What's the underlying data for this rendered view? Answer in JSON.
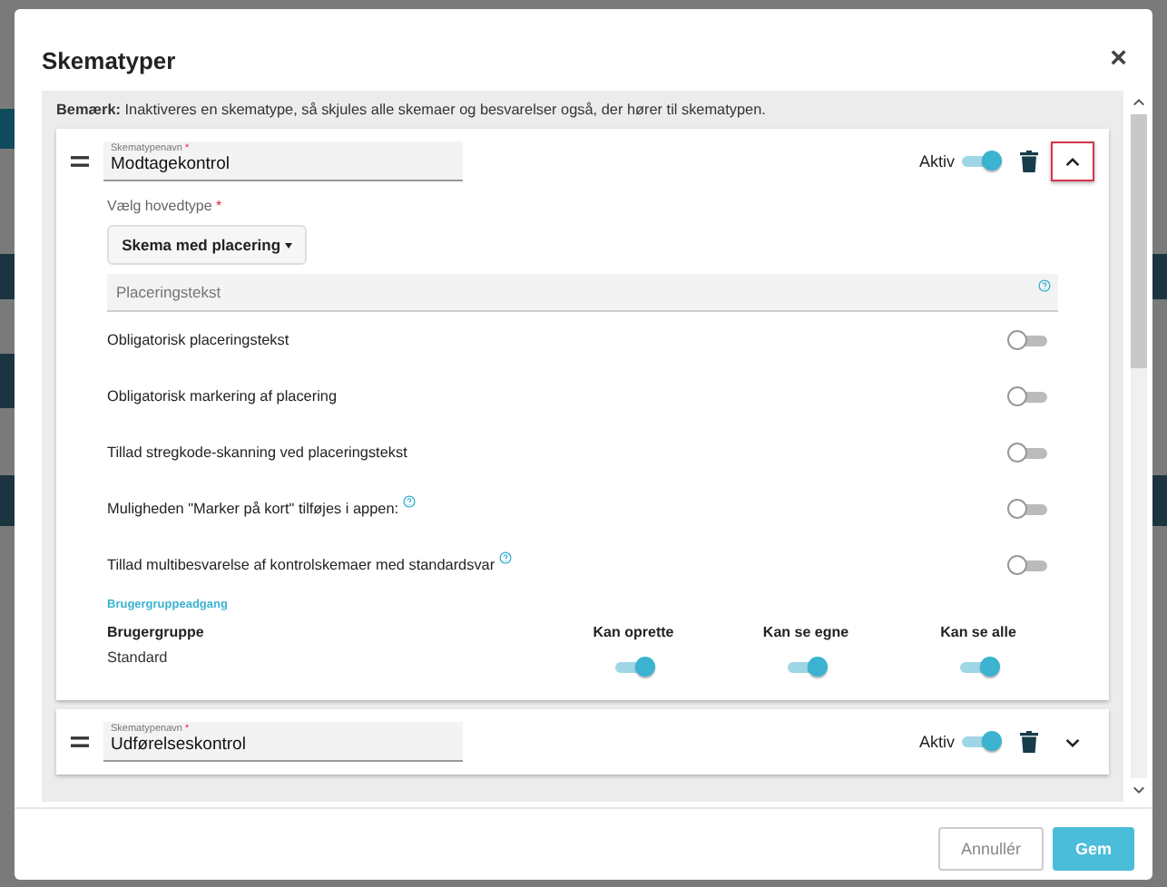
{
  "modal": {
    "title": "Skematyper",
    "close": "×"
  },
  "note": "**Bemærk:** Inaktiveres en skematype, så skjules alle skemaer og besvarelser også, der hører til skematypen.",
  "schema_types": [
    {
      "name_label": "Skematypenavn",
      "required_mark": "*",
      "value": "Modtagekontrol",
      "active_label": "Aktiv",
      "active": true,
      "expanded": true,
      "focused": true,
      "main_type": {
        "label": "Vælg hovedtype",
        "required_mark": "*",
        "value": "Skema med placering"
      },
      "placement_field": {
        "placeholder": "Placeringstekst"
      },
      "options": [
        {
          "label": "Obligatorisk placeringstekst",
          "help": false,
          "on": false
        },
        {
          "label": "Obligatorisk markering af placering",
          "help": false,
          "on": false
        },
        {
          "label": "Tillad stregkode-skanning ved placeringstekst",
          "help": false,
          "on": false
        },
        {
          "label": "Muligheden \"Marker på kort\" tilføjes i appen:",
          "help": true,
          "on": false
        },
        {
          "label": "Tillad multibesvarelse af kontrolskemaer med standardsvar",
          "help": true,
          "on": false
        }
      ],
      "access": {
        "title": "Brugergruppeadgang",
        "columns": [
          "Brugergruppe",
          "Kan oprette",
          "Kan se egne",
          "Kan se alle"
        ],
        "rows": [
          {
            "group": "Standard",
            "permissions": [
              true,
              true,
              true
            ]
          }
        ]
      }
    },
    {
      "name_label": "Skematypenavn",
      "required_mark": "*",
      "value": "Udførelseskontrol",
      "active_label": "Aktiv",
      "active": true,
      "expanded": false,
      "focused": false
    }
  ],
  "buttons": [
    {
      "label": "Annullér",
      "kind": "secondary"
    },
    {
      "label": "Gem",
      "kind": "primary"
    }
  ]
}
